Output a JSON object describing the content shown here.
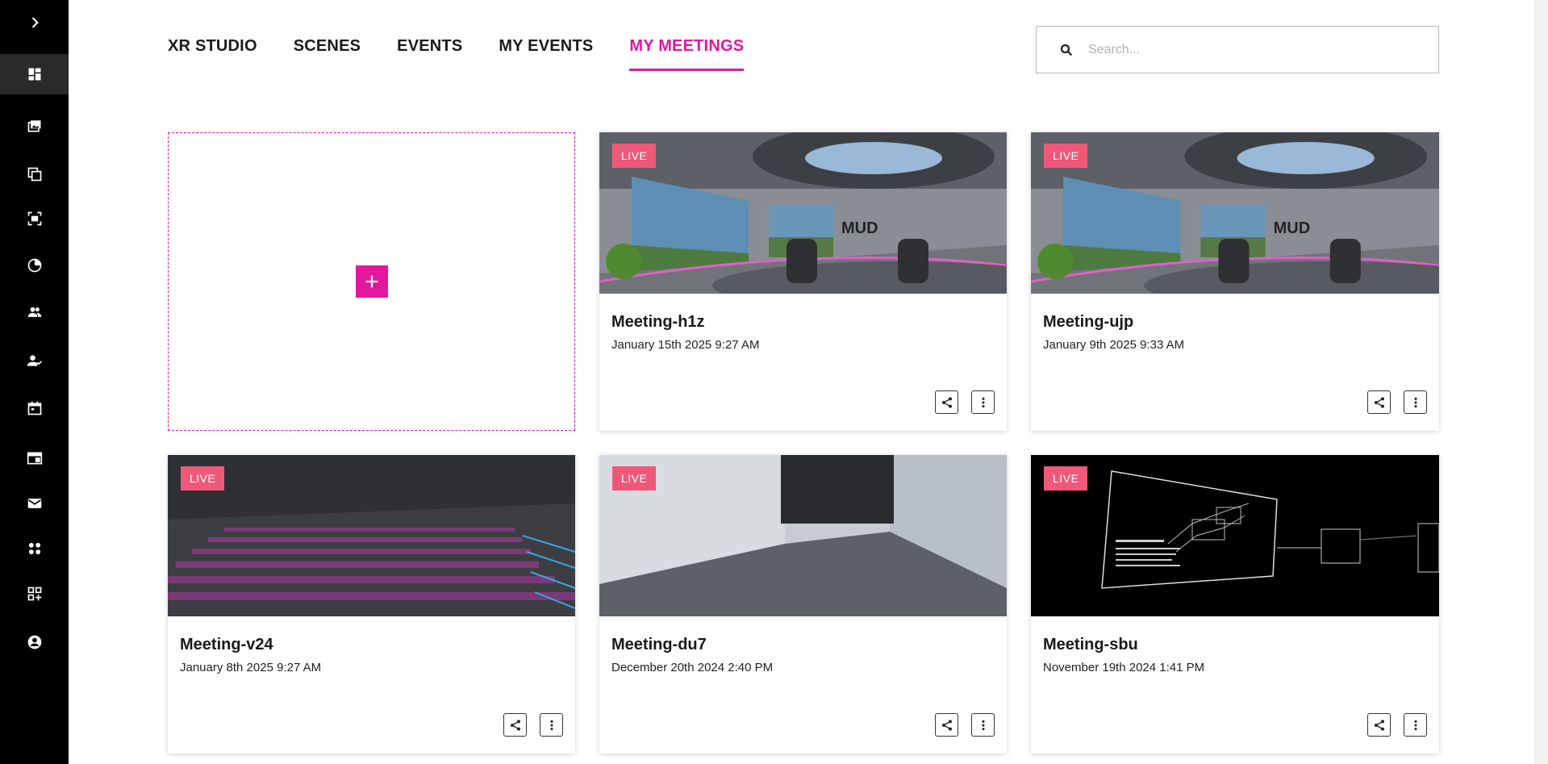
{
  "nav": {
    "tabs": [
      {
        "label": "XR STUDIO"
      },
      {
        "label": "SCENES"
      },
      {
        "label": "EVENTS"
      },
      {
        "label": "MY EVENTS"
      },
      {
        "label": "MY MEETINGS"
      }
    ],
    "active_tab": "MY MEETINGS"
  },
  "search": {
    "placeholder": "Search..."
  },
  "sidebar": {
    "icons": [
      "chevron-right-icon",
      "dashboard-icon",
      "gallery-icon",
      "copy-icon",
      "scan-icon",
      "pie-chart-icon",
      "people-icon",
      "user-check-icon",
      "calendar-icon",
      "layout-icon",
      "mail-icon",
      "apps-icon",
      "add-grid-icon",
      "account-icon"
    ]
  },
  "colors": {
    "accent": "#e2179e",
    "live_badge": "#f0587a",
    "sidebar": "#000000"
  },
  "meetings": [
    {
      "badge": "LIVE",
      "title": "Meeting-h1z",
      "date": "January 15th 2025 9:27 AM"
    },
    {
      "badge": "LIVE",
      "title": "Meeting-ujp",
      "date": "January 9th 2025 9:33 AM"
    },
    {
      "badge": "LIVE",
      "title": "Meeting-v24",
      "date": "January 8th 2025 9:27 AM"
    },
    {
      "badge": "LIVE",
      "title": "Meeting-du7",
      "date": "December 20th 2024 2:40 PM"
    },
    {
      "badge": "LIVE",
      "title": "Meeting-sbu",
      "date": "November 19th 2024 1:41 PM"
    }
  ]
}
